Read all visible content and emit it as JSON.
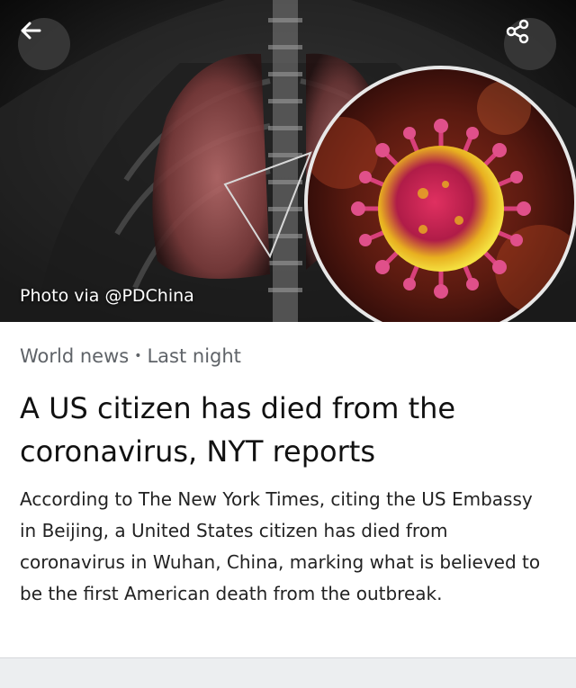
{
  "hero": {
    "caption": "Photo via @PDChina"
  },
  "toolbar": {
    "back_icon": "arrow-left-icon",
    "share_icon": "share-icon"
  },
  "article": {
    "category": "World news",
    "separator": "•",
    "time": "Last night",
    "headline": "A US citizen has died from the coronavirus, NYT reports",
    "body": "According to The New York Times, citing the US Embassy in Beijing, a United States citizen has died from coronavirus in Wuhan, China, marking what is believed to be the first American death from the outbreak."
  },
  "colors": {
    "virus_core": "#c0204a",
    "virus_glow": "#f0d020",
    "lung_tint": "#a85a5a"
  }
}
